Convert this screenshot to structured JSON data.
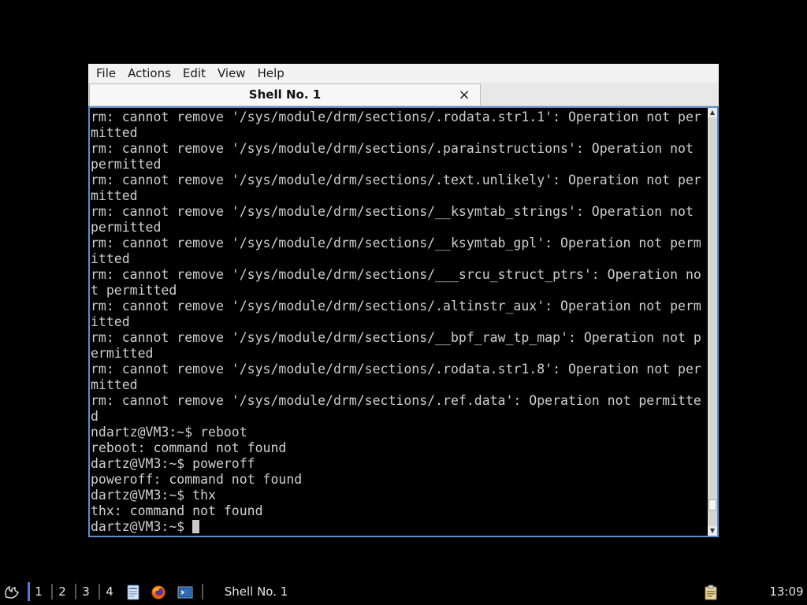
{
  "window": {
    "menu": [
      "File",
      "Actions",
      "Edit",
      "View",
      "Help"
    ],
    "tab_title": "Shell No. 1",
    "tab_close_icon": "×"
  },
  "terminal": {
    "lines": [
      "rm: cannot remove '/sys/module/drm/sections/.rodata.str1.1': Operation not per",
      "mitted",
      "rm: cannot remove '/sys/module/drm/sections/.parainstructions': Operation not",
      "permitted",
      "rm: cannot remove '/sys/module/drm/sections/.text.unlikely': Operation not per",
      "mitted",
      "rm: cannot remove '/sys/module/drm/sections/__ksymtab_strings': Operation not",
      "permitted",
      "rm: cannot remove '/sys/module/drm/sections/__ksymtab_gpl': Operation not perm",
      "itted",
      "rm: cannot remove '/sys/module/drm/sections/___srcu_struct_ptrs': Operation no",
      "t permitted",
      "rm: cannot remove '/sys/module/drm/sections/.altinstr_aux': Operation not perm",
      "itted",
      "rm: cannot remove '/sys/module/drm/sections/__bpf_raw_tp_map': Operation not p",
      "ermitted",
      "rm: cannot remove '/sys/module/drm/sections/.rodata.str1.8': Operation not per",
      "mitted",
      "rm: cannot remove '/sys/module/drm/sections/.ref.data': Operation not permitte",
      "d",
      "ndartz@VM3:~$ reboot",
      "reboot: command not found",
      "dartz@VM3:~$ poweroff",
      "poweroff: command not found",
      "dartz@VM3:~$ thx",
      "thx: command not found"
    ],
    "prompt": "dartz@VM3:~$ ",
    "scroll_position": 0.96,
    "colors": {
      "background": "#000000",
      "text": "#cfcfcf",
      "focus_border": "#5b8ecf"
    }
  },
  "taskbar": {
    "start_icon": "lxde-start-icon",
    "desktops": [
      "1",
      "2",
      "3",
      "4"
    ],
    "active_desktop": "1",
    "launchers": [
      "file-manager-icon",
      "firefox-icon",
      "terminal-icon"
    ],
    "task_title": "Shell No. 1",
    "tray_icon": "clipboard-icon",
    "clock": "13:09"
  }
}
